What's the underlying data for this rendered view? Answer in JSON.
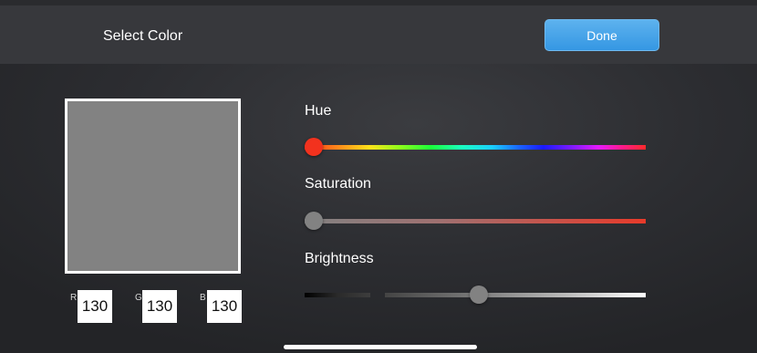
{
  "header": {
    "title": "Select Color",
    "done_label": "Done"
  },
  "preview": {
    "color": "#828282"
  },
  "rgb": [
    {
      "letter": "R",
      "value": "130"
    },
    {
      "letter": "G",
      "value": "130"
    },
    {
      "letter": "B",
      "value": "130"
    }
  ],
  "sliders": {
    "hue": {
      "label": "Hue",
      "value_fraction": 0.0,
      "thumb_color": "#f2321e"
    },
    "saturation": {
      "label": "Saturation",
      "value_fraction": 0.0,
      "thumb_color": "#828282"
    },
    "brightness": {
      "label": "Brightness",
      "value_fraction": 0.51,
      "thumb_color": "#828282"
    }
  },
  "colors": {
    "accent": "#3597e3",
    "background": "#2c2d31"
  }
}
